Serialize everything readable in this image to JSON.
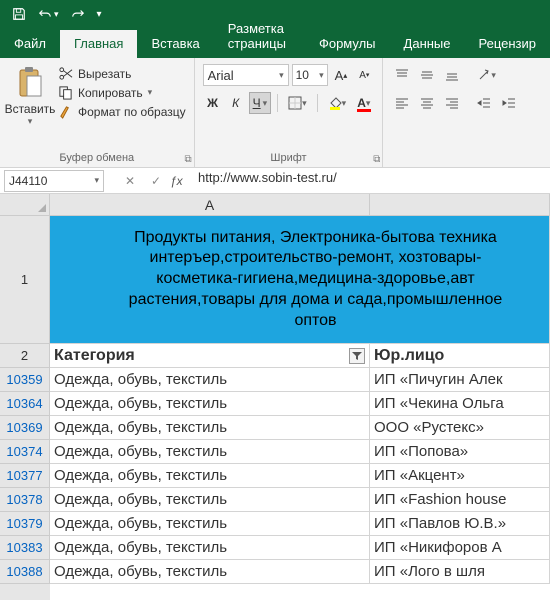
{
  "titlebar": {
    "save": "save",
    "undo": "undo",
    "redo": "redo"
  },
  "tabs": {
    "file": "Файл",
    "home": "Главная",
    "insert": "Вставка",
    "layout": "Разметка страницы",
    "formulas": "Формулы",
    "data": "Данные",
    "review": "Рецензир"
  },
  "ribbon": {
    "clipboard": {
      "group": "Буфер обмена",
      "paste": "Вставить",
      "cut": "Вырезать",
      "copy": "Копировать",
      "format": "Формат по образцу"
    },
    "font": {
      "group": "Шрифт",
      "name": "Arial",
      "size": "10"
    },
    "alignment": {
      "group": ""
    }
  },
  "namebox": "J44110",
  "formula": "http://www.sobin-test.ru/",
  "colA": "A",
  "rows": [
    "1",
    "2",
    "10359",
    "10364",
    "10369",
    "10374",
    "10377",
    "10378",
    "10379",
    "10383",
    "10388"
  ],
  "banner": "Продукты питания, Электроника-бытова техника\nинтеръер,строительство-ремонт, хозтовары-\nкосметика-гигиена,медицина-здоровье,авт\nрастения,товары для дома и сада,промышленное\nоптов",
  "header": {
    "a": "Категория",
    "b": "Юр.лицо"
  },
  "data": [
    {
      "a": "Одежда, обувь, текстиль",
      "b": "ИП «Пичугин Алек"
    },
    {
      "a": "Одежда, обувь, текстиль",
      "b": "ИП «Чекина Ольга"
    },
    {
      "a": "Одежда, обувь, текстиль",
      "b": "ООО «Рустекс»"
    },
    {
      "a": "Одежда, обувь, текстиль",
      "b": "ИП «Попова»"
    },
    {
      "a": "Одежда, обувь, текстиль",
      "b": "ИП «Акцент»"
    },
    {
      "a": "Одежда, обувь, текстиль",
      "b": "ИП «Fashion house"
    },
    {
      "a": "Одежда, обувь, текстиль",
      "b": "ИП «Павлов Ю.В.»"
    },
    {
      "a": "Одежда, обувь, текстиль",
      "b": "ИП «Никифоров А"
    },
    {
      "a": "Одежда, обувь, текстиль",
      "b": "ИП «Лого в шля"
    }
  ]
}
